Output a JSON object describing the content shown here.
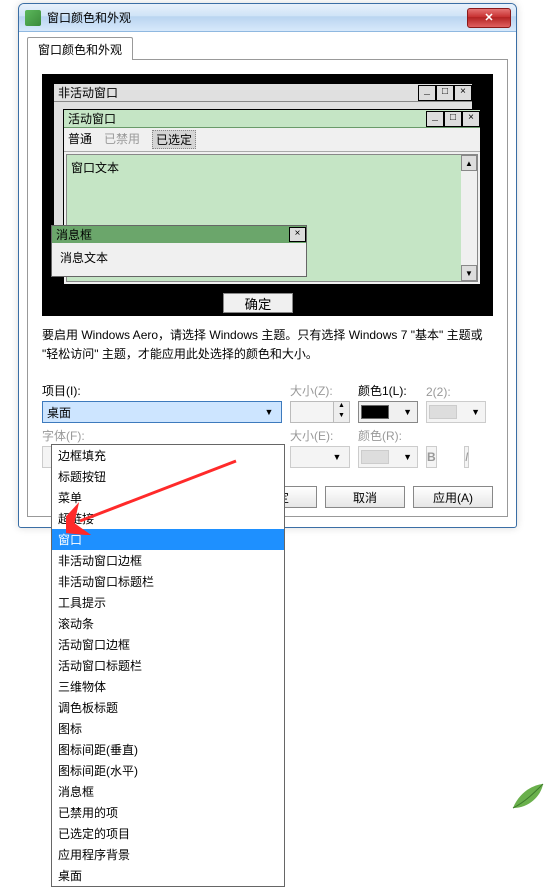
{
  "window": {
    "title": "窗口颜色和外观",
    "close_glyph": "✕"
  },
  "tab": {
    "label": "窗口颜色和外观"
  },
  "preview": {
    "inactive_title": "非活动窗口",
    "active_title": "活动窗口",
    "menu_normal": "普通",
    "menu_disabled": "已禁用",
    "menu_selected": "已选定",
    "window_text": "窗口文本",
    "msgbox_title": "消息框",
    "msgbox_text": "消息文本",
    "ok": "确定",
    "min_glyph": "_",
    "max_glyph": "□",
    "close_glyph": "×",
    "up_glyph": "▲",
    "down_glyph": "▼"
  },
  "info_text": "要启用 Windows Aero，请选择 Windows 主题。只有选择 Windows 7 \"基本\" 主题或 \"轻松访问\" 主题，才能应用此处选择的颜色和大小。",
  "labels": {
    "item": "项目(I):",
    "size_z": "大小(Z):",
    "color1": "颜色1(L):",
    "color2": "2(2):",
    "font": "字体(F):",
    "size_e": "大小(E):",
    "color_r": "颜色(R):",
    "bold": "B",
    "italic": "I"
  },
  "combo": {
    "selected": "桌面"
  },
  "colors": {
    "swatch1": "#000000"
  },
  "buttons": {
    "ok": "确定",
    "cancel": "取消",
    "apply": "应用(A)"
  },
  "dropdown_items": [
    "边框填充",
    "标题按钮",
    "菜单",
    "超链接",
    "窗口",
    "非活动窗口边框",
    "非活动窗口标题栏",
    "工具提示",
    "滚动条",
    "活动窗口边框",
    "活动窗口标题栏",
    "三维物体",
    "调色板标题",
    "图标",
    "图标间距(垂直)",
    "图标间距(水平)",
    "消息框",
    "已禁用的项",
    "已选定的项目",
    "应用程序背景",
    "桌面"
  ],
  "selected_item_index": 4
}
